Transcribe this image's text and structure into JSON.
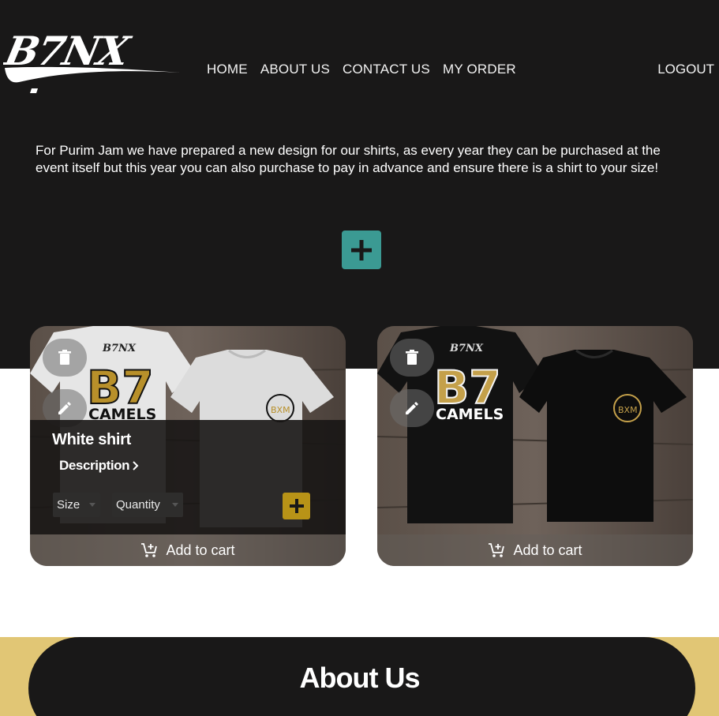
{
  "header": {
    "logo_text": "B7NX",
    "nav": [
      "HOME",
      "ABOUT US",
      "CONTACT US",
      "MY ORDER"
    ],
    "logout": "LOGOUT"
  },
  "intro_text": "For Purim Jam we have prepared a new design for our shirts, as every year they can be purchased at the event itself but this year you can also purchase to pay in advance and ensure there is a shirt to your size!",
  "products": [
    {
      "title": "White shirt",
      "description_label": "Description",
      "size_label": "Size",
      "quantity_label": "Quantity",
      "cart_label": "Add to cart",
      "shirt_color": "#e8e8e8",
      "print_text": "B7",
      "print_subtext": "CAMELS",
      "back_logo": "B7NX",
      "badge_letters": "BXM"
    },
    {
      "cart_label": "Add to cart",
      "shirt_color": "#111111",
      "print_text": "B7",
      "print_subtext": "CAMELS",
      "back_logo": "B7NX",
      "badge_letters": "BXM"
    }
  ],
  "about": {
    "title": "About Us"
  },
  "colors": {
    "hero_bg": "#191818",
    "teal_accent": "#3b9a93",
    "gold_accent": "#b89317",
    "about_gold": "#e1c675"
  },
  "icons": [
    "logo",
    "plus-icon",
    "trash-icon",
    "pencil-icon",
    "chevron-right-icon",
    "add-cart-icon"
  ]
}
